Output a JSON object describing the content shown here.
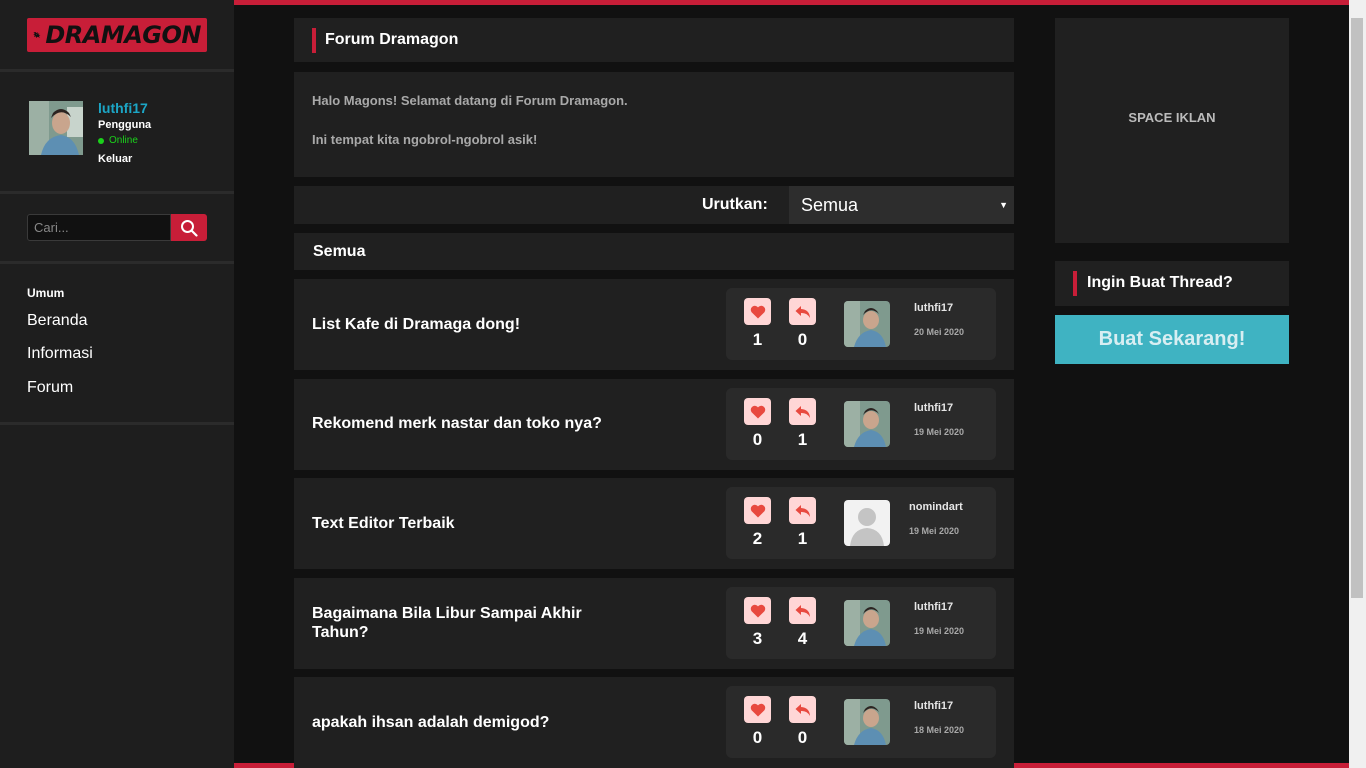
{
  "brand": {
    "name": "DRAMAGON",
    "accent": "#c81e38",
    "link_color": "#1ca6c6",
    "cta_color": "#3fb3c2"
  },
  "profile": {
    "username": "luthfi17",
    "role": "Pengguna",
    "status": "Online",
    "logout": "Keluar"
  },
  "search": {
    "placeholder": "Cari..."
  },
  "nav": {
    "category": "Umum",
    "items": [
      {
        "label": "Beranda"
      },
      {
        "label": "Informasi"
      },
      {
        "label": "Forum"
      }
    ]
  },
  "header": {
    "title": "Forum Dramagon"
  },
  "welcome": {
    "line1": "Halo Magons! Selamat datang di Forum Dramagon.",
    "line2": "Ini tempat kita ngobrol-ngobrol asik!"
  },
  "sort": {
    "label": "Urutkan:",
    "selected": "Semua"
  },
  "section": {
    "title": "Semua"
  },
  "threads": [
    {
      "title": "List Kafe di Dramaga dong!",
      "likes": "1",
      "replies": "0",
      "author": "luthfi17",
      "date": "20 Mei 2020",
      "avatar": "photo"
    },
    {
      "title": "Rekomend merk nastar dan toko nya?",
      "likes": "0",
      "replies": "1",
      "author": "luthfi17",
      "date": "19 Mei 2020",
      "avatar": "photo"
    },
    {
      "title": "Text Editor Terbaik",
      "likes": "2",
      "replies": "1",
      "author": "nomindart",
      "date": "19 Mei 2020",
      "avatar": "default"
    },
    {
      "title": "Bagaimana Bila Libur Sampai Akhir Tahun?",
      "likes": "3",
      "replies": "4",
      "author": "luthfi17",
      "date": "19 Mei 2020",
      "avatar": "photo"
    },
    {
      "title": "apakah ihsan adalah demigod?",
      "likes": "0",
      "replies": "0",
      "author": "luthfi17",
      "date": "18 Mei 2020",
      "avatar": "photo"
    }
  ],
  "ad": {
    "label": "SPACE IKLAN"
  },
  "cta": {
    "heading": "Ingin Buat Thread?",
    "button": "Buat Sekarang!"
  },
  "icons": {
    "like": "heart-icon",
    "reply": "reply-icon",
    "search": "search-icon"
  }
}
